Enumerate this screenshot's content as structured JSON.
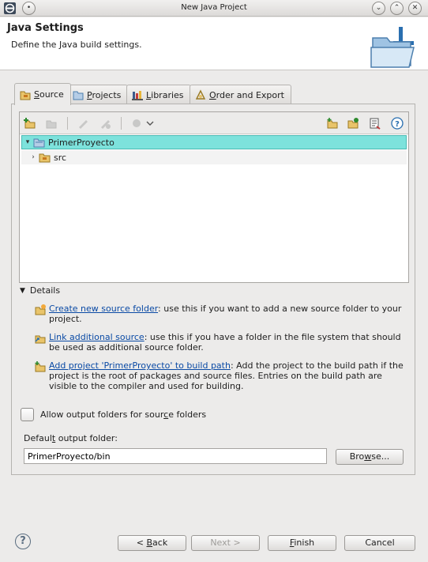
{
  "window": {
    "title": "New Java Project"
  },
  "header": {
    "title": "Java Settings",
    "description": "Define the Java build settings."
  },
  "tabs": [
    {
      "label": "Source",
      "mnemonic": "S",
      "rest": "ource"
    },
    {
      "label": "Projects",
      "mnemonic": "P",
      "rest": "rojects"
    },
    {
      "label": "Libraries",
      "mnemonic": "L",
      "rest": "ibraries"
    },
    {
      "label": "Order and Export",
      "mnemonic": "O",
      "rest": "rder and Export"
    }
  ],
  "tree": {
    "root": "PrimerProyecto",
    "child": "src"
  },
  "details": {
    "heading": "Details",
    "items": [
      {
        "link": "Create new source folder",
        "text": ": use this if you want to add a new source folder to your project."
      },
      {
        "link": "Link additional source",
        "text": ": use this if you have a folder in the file system that should be used as additional source folder."
      },
      {
        "link": "Add project 'PrimerProyecto' to build path",
        "text": ": Add the project to the build path if the project is the root of packages and source files. Entries on the build path are visible to the compiler and used for building."
      }
    ]
  },
  "checkbox": {
    "pre": "Allow output folders for sour",
    "mnemonic": "c",
    "post": "e folders"
  },
  "output": {
    "label_pre": "Defaul",
    "label_mn": "t",
    "label_post": " output folder:",
    "value": "PrimerProyecto/bin",
    "browse_pre": "Bro",
    "browse_mn": "w",
    "browse_post": "se..."
  },
  "buttons": {
    "back_pre": "< ",
    "back_mn": "B",
    "back_post": "ack",
    "next": "Next >",
    "finish_mn": "F",
    "finish_post": "inish",
    "cancel": "Cancel"
  },
  "colors": {
    "selection": "#7de2dc",
    "link": "#0a4aa5"
  }
}
